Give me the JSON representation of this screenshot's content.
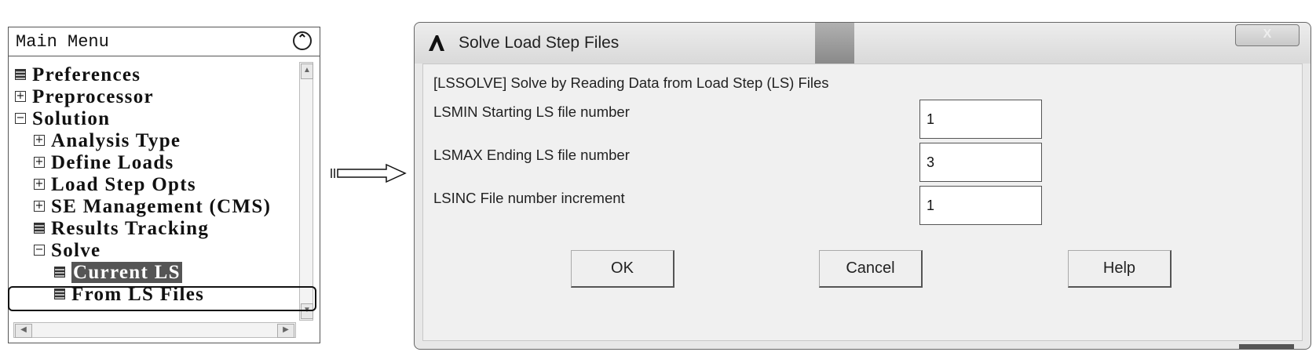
{
  "menu": {
    "title": "Main Menu",
    "collapse_icon": "double-chevron-up-icon",
    "items": [
      {
        "label": "Preferences",
        "icon": "doc-icon",
        "level": 0
      },
      {
        "label": "Preprocessor",
        "icon": "plus-box-icon",
        "level": 0
      },
      {
        "label": "Solution",
        "icon": "minus-box-icon",
        "level": 0
      },
      {
        "label": "Analysis Type",
        "icon": "plus-box-icon",
        "level": 1
      },
      {
        "label": "Define Loads",
        "icon": "plus-box-icon",
        "level": 1
      },
      {
        "label": "Load Step Opts",
        "icon": "plus-box-icon",
        "level": 1
      },
      {
        "label": "SE Management (CMS)",
        "icon": "plus-box-icon",
        "level": 1
      },
      {
        "label": "Results Tracking",
        "icon": "doc-icon",
        "level": 1
      },
      {
        "label": "Solve",
        "icon": "minus-box-icon",
        "level": 1
      },
      {
        "label": "Current LS",
        "icon": "doc-icon",
        "level": 2
      },
      {
        "label": "From LS Files",
        "icon": "doc-icon",
        "level": 2
      }
    ]
  },
  "dialog": {
    "title": "Solve Load Step Files",
    "close_label": "X",
    "description": "[LSSOLVE]  Solve by Reading Data from Load Step (LS) Files",
    "fields": [
      {
        "label": "LSMIN  Starting LS file number",
        "value": "1"
      },
      {
        "label": "LSMAX  Ending LS file number",
        "value": "3"
      },
      {
        "label": "LSINC  File number increment",
        "value": "1"
      }
    ],
    "buttons": {
      "ok": "OK",
      "cancel": "Cancel",
      "help": "Help"
    }
  }
}
